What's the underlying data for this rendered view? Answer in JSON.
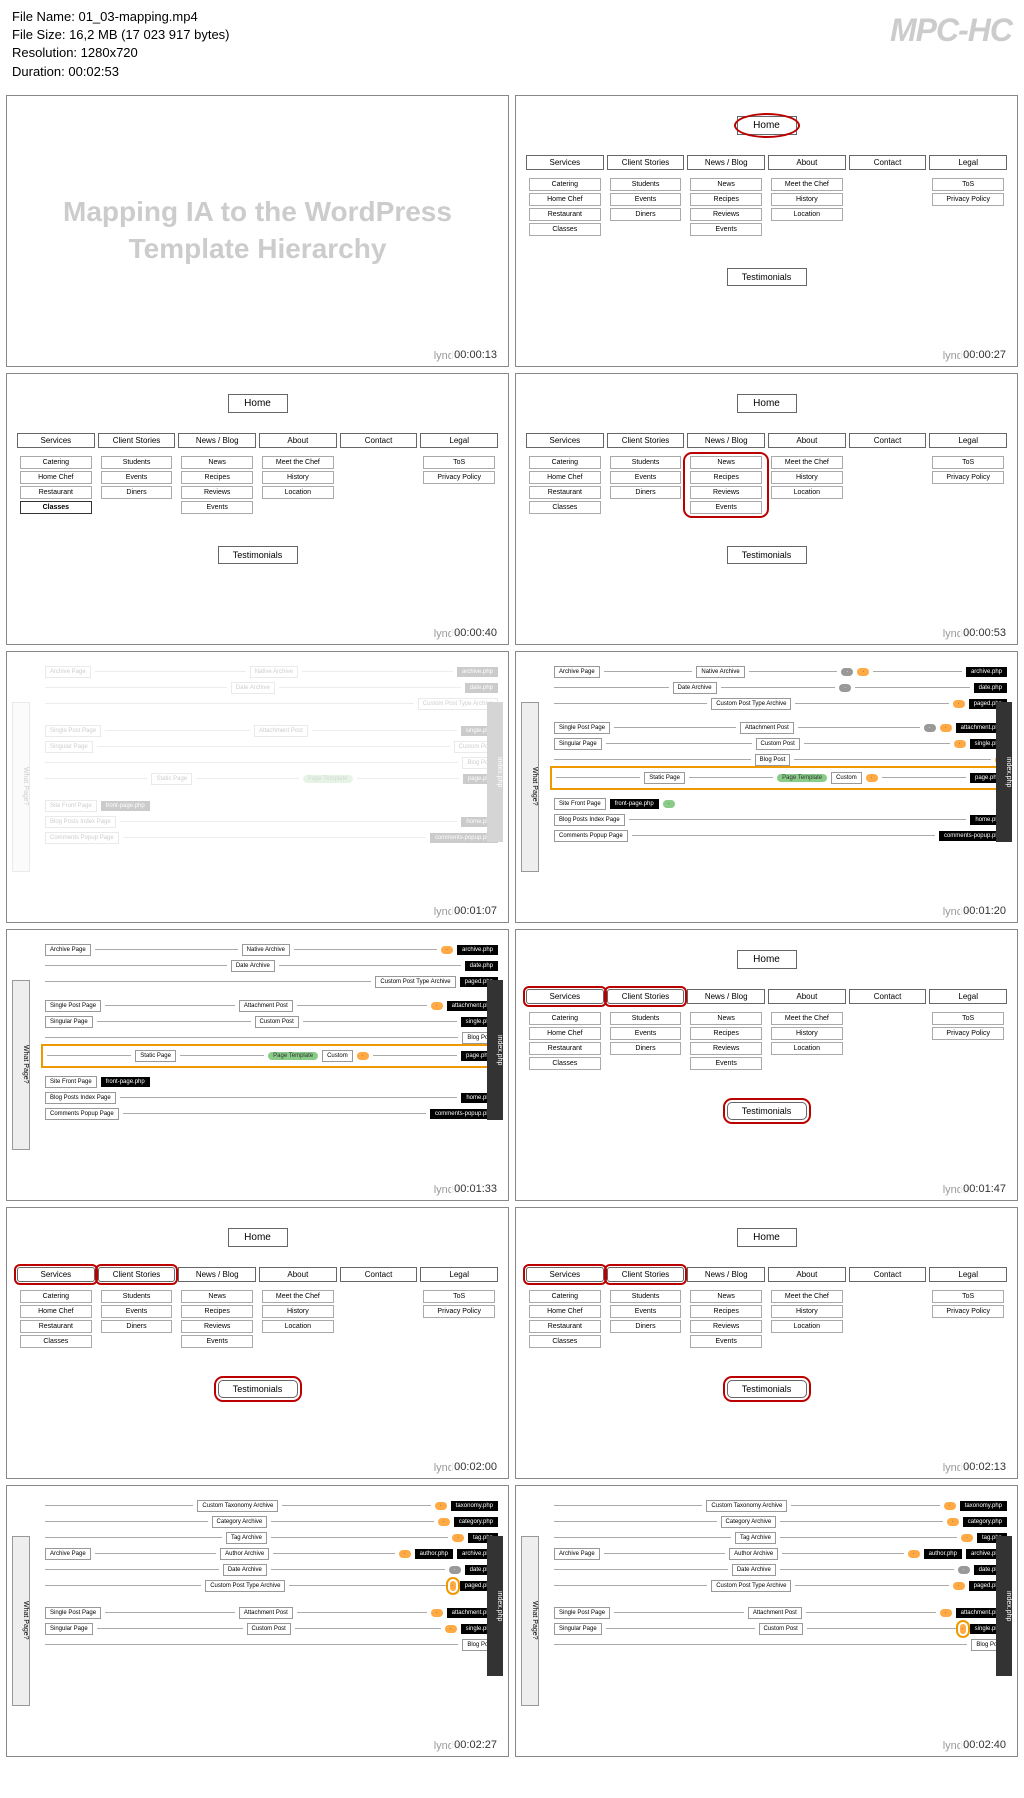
{
  "player": {
    "name": "MPC-HC"
  },
  "fileInfo": {
    "name": "File Name: 01_03-mapping.mp4",
    "size": "File Size: 16,2 MB (17 023 917 bytes)",
    "resolution": "Resolution: 1280x720",
    "duration": "Duration: 00:02:53"
  },
  "slideTitle": "Mapping IA to the WordPress Template Hierarchy",
  "brand": "lynda",
  "ia": {
    "home": "Home",
    "sections": [
      "Services",
      "Client Stories",
      "News / Blog",
      "About",
      "Contact",
      "Legal"
    ],
    "servicesItems": [
      "Catering",
      "Home Chef",
      "Restaurant",
      "Classes"
    ],
    "clientItems": [
      "Students",
      "Events",
      "Diners"
    ],
    "newsItems": [
      "News",
      "Recipes",
      "Reviews",
      "Events"
    ],
    "aboutItems": [
      "Meet the Chef",
      "History",
      "Location"
    ],
    "legalItems": [
      "ToS",
      "Privacy Policy"
    ],
    "testimonials": "Testimonials"
  },
  "flow": {
    "sidebar": "What Page?",
    "index": "index.php",
    "archive": "Archive Page",
    "nativeArchive": "Native Archive",
    "dateArchive": "Date Archive",
    "customPost": "Custom Post Type Archive",
    "attachment": "Attachment Post",
    "singlePost": "Single Post Page",
    "customPostSingle": "Custom Post",
    "blogPost": "Blog Post",
    "singularPage": "Singular Page",
    "staticPage": "Static Page",
    "pageTemplate": "Page Template",
    "custom": "Custom",
    "default": "Default",
    "siteFront": "Site Front Page",
    "frontPage": "front-page.php",
    "blogPosts": "Blog Posts Index Page",
    "comments": "Comments Popup Page",
    "archivePhp": "archive.php",
    "datePhp": "date.php",
    "pagedPhp": "paged.php",
    "singlePhp": "single.php",
    "pagePhp": "page.php",
    "homePhp": "home.php",
    "commentsPhp": "comments-popup.php",
    "authorPhp": "author.php",
    "authorArchive": "Author Archive",
    "customTaxArchive": "Custom Taxonomy Archive",
    "categoryArchive": "Category Archive",
    "tagArchive": "Tag Archive",
    "taxonomyPhp": "taxonomy.php",
    "categoryPhp": "category.php",
    "tagPhp": "tag.php",
    "attachmentPhp": "attachment.php"
  },
  "thumbnails": [
    {
      "time": "00:00:13",
      "type": "title"
    },
    {
      "time": "00:00:27",
      "type": "ia",
      "highlight": "home"
    },
    {
      "time": "00:00:40",
      "type": "ia",
      "highlight": "classes"
    },
    {
      "time": "00:00:53",
      "type": "ia",
      "highlight": "news-group"
    },
    {
      "time": "00:01:07",
      "type": "flow-faded"
    },
    {
      "time": "00:01:20",
      "type": "flow",
      "highlight": "static-page"
    },
    {
      "time": "00:01:33",
      "type": "flow",
      "highlight": "static-page"
    },
    {
      "time": "00:01:47",
      "type": "ia",
      "highlight": "services-client-testimonials"
    },
    {
      "time": "00:02:00",
      "type": "ia",
      "highlight": "services-client-testimonials"
    },
    {
      "time": "00:02:13",
      "type": "ia",
      "highlight": "services-client-testimonials"
    },
    {
      "time": "00:02:27",
      "type": "flow-archive"
    },
    {
      "time": "00:02:40",
      "type": "flow-archive"
    }
  ]
}
